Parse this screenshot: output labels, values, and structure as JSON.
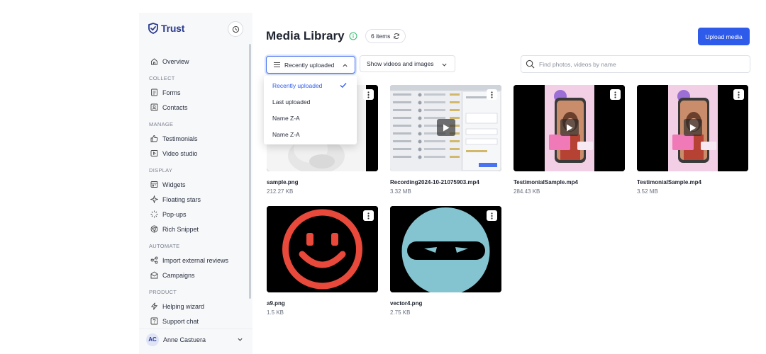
{
  "brand": {
    "name": "Trust"
  },
  "sidebar": {
    "items": [
      {
        "type": "item",
        "label": "Overview",
        "icon": "home-icon"
      },
      {
        "type": "section",
        "label": "COLLECT"
      },
      {
        "type": "item",
        "label": "Forms",
        "icon": "form-icon"
      },
      {
        "type": "item",
        "label": "Contacts",
        "icon": "contacts-icon"
      },
      {
        "type": "section",
        "label": "MANAGE"
      },
      {
        "type": "item",
        "label": "Testimonials",
        "icon": "thumbs-up-icon"
      },
      {
        "type": "item",
        "label": "Video studio",
        "icon": "video-icon"
      },
      {
        "type": "section",
        "label": "DISPLAY"
      },
      {
        "type": "item",
        "label": "Widgets",
        "icon": "widget-icon"
      },
      {
        "type": "item",
        "label": "Floating stars",
        "icon": "sparkle-icon"
      },
      {
        "type": "item",
        "label": "Pop-ups",
        "icon": "loader-icon"
      },
      {
        "type": "item",
        "label": "Rich Snippet",
        "icon": "chrome-icon"
      },
      {
        "type": "section",
        "label": "AUTOMATE"
      },
      {
        "type": "item",
        "label": "Import external reviews",
        "icon": "share-icon"
      },
      {
        "type": "item",
        "label": "Campaigns",
        "icon": "mail-icon"
      },
      {
        "type": "section",
        "label": "PRODUCT"
      },
      {
        "type": "item",
        "label": "Helping wizard",
        "icon": "bolt-icon"
      },
      {
        "type": "item",
        "label": "Support chat",
        "icon": "help-icon"
      }
    ]
  },
  "user": {
    "initials": "AC",
    "name": "Anne Castuera"
  },
  "header": {
    "title": "Media Library",
    "count": "6 items",
    "upload_label": "Upload media"
  },
  "toolbar": {
    "sort_label": "Recently uploaded",
    "filter_label": "Show videos and images",
    "search_placeholder": "Find photos, videos by name"
  },
  "sort_options": [
    {
      "label": "Recently uploaded",
      "selected": true
    },
    {
      "label": "Last uploaded",
      "selected": false
    },
    {
      "label": "Name Z-A",
      "selected": false
    },
    {
      "label": "Name Z-A",
      "selected": false
    }
  ],
  "media": [
    {
      "name": "sample.png",
      "size": "212.27 KB",
      "kind": "image",
      "thumb": "cat"
    },
    {
      "name": "Recording2024-10-21075903.mp4",
      "size": "3.32 MB",
      "kind": "video",
      "thumb": "screen"
    },
    {
      "name": "TestimonialSample.mp4",
      "size": "284.43 KB",
      "kind": "video",
      "thumb": "phone"
    },
    {
      "name": "TestimonialSample.mp4",
      "size": "3.52 MB",
      "kind": "video",
      "thumb": "phone"
    },
    {
      "name": "a9.png",
      "size": "1.5 KB",
      "kind": "image",
      "thumb": "smiley"
    },
    {
      "name": "vector4.png",
      "size": "2.75 KB",
      "kind": "image",
      "thumb": "ninja"
    }
  ],
  "colors": {
    "accent": "#2f5bea",
    "brand": "#2b3b8f",
    "info": "#2fb86b"
  }
}
